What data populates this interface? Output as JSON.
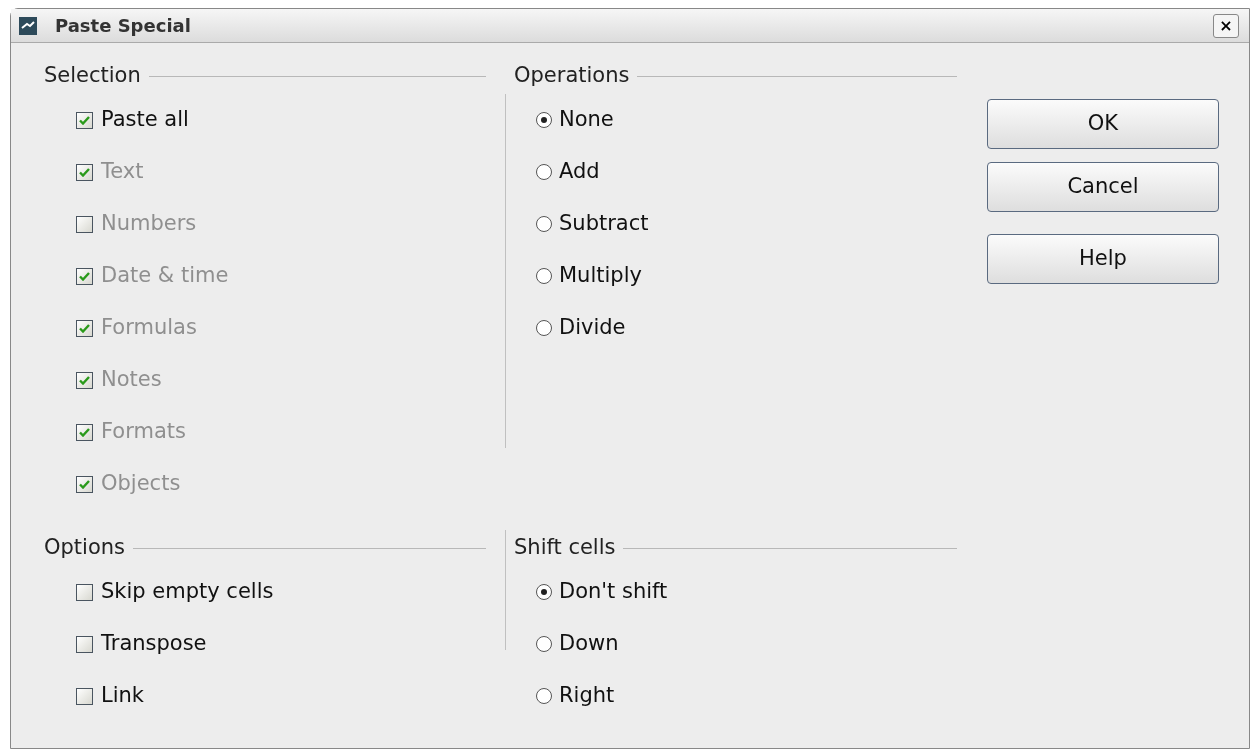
{
  "window": {
    "title": "Paste Special",
    "close": "×"
  },
  "selection": {
    "title": "Selection",
    "items": [
      {
        "label": "Paste all",
        "checked": true,
        "disabled": false
      },
      {
        "label": "Text",
        "checked": true,
        "disabled": true
      },
      {
        "label": "Numbers",
        "checked": false,
        "disabled": true
      },
      {
        "label": "Date & time",
        "checked": true,
        "disabled": true
      },
      {
        "label": "Formulas",
        "checked": true,
        "disabled": true
      },
      {
        "label": "Notes",
        "checked": true,
        "disabled": true
      },
      {
        "label": "Formats",
        "checked": true,
        "disabled": true
      },
      {
        "label": "Objects",
        "checked": true,
        "disabled": true
      }
    ]
  },
  "operations": {
    "title": "Operations",
    "items": [
      {
        "label": "None",
        "selected": true
      },
      {
        "label": "Add",
        "selected": false
      },
      {
        "label": "Subtract",
        "selected": false
      },
      {
        "label": "Multiply",
        "selected": false
      },
      {
        "label": "Divide",
        "selected": false
      }
    ]
  },
  "options": {
    "title": "Options",
    "items": [
      {
        "label": "Skip empty cells",
        "checked": false,
        "disabled": false
      },
      {
        "label": "Transpose",
        "checked": false,
        "disabled": false
      },
      {
        "label": "Link",
        "checked": false,
        "disabled": false
      }
    ]
  },
  "shift_cells": {
    "title": "Shift cells",
    "items": [
      {
        "label": "Don't shift",
        "selected": true
      },
      {
        "label": "Down",
        "selected": false
      },
      {
        "label": "Right",
        "selected": false
      }
    ]
  },
  "buttons": [
    {
      "label": "OK"
    },
    {
      "label": "Cancel"
    },
    {
      "label": "Help"
    }
  ]
}
